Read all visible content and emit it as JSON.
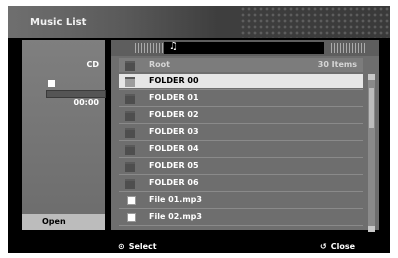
{
  "window": {
    "title": "Music List"
  },
  "left_panel": {
    "source": "CD",
    "time": "00:00",
    "progress": 0,
    "open_label": "Open"
  },
  "list": {
    "root_label": "Root",
    "item_count": "30 Items",
    "items": [
      {
        "type": "folder",
        "name": "FOLDER 00",
        "selected": true
      },
      {
        "type": "folder",
        "name": "FOLDER 01"
      },
      {
        "type": "folder",
        "name": "FOLDER 02"
      },
      {
        "type": "folder",
        "name": "FOLDER 03"
      },
      {
        "type": "folder",
        "name": "FOLDER 04"
      },
      {
        "type": "folder",
        "name": "FOLDER 05"
      },
      {
        "type": "folder",
        "name": "FOLDER 06"
      },
      {
        "type": "file",
        "name": "File 01.mp3"
      },
      {
        "type": "file",
        "name": "File 02.mp3"
      }
    ]
  },
  "footer": {
    "select_label": "Select",
    "close_label": "Close"
  },
  "icons": {
    "music": "music-note-icon",
    "folder": "folder-icon",
    "file": "file-icon",
    "stop": "stop-icon",
    "select": "select-icon",
    "close": "close-icon"
  }
}
